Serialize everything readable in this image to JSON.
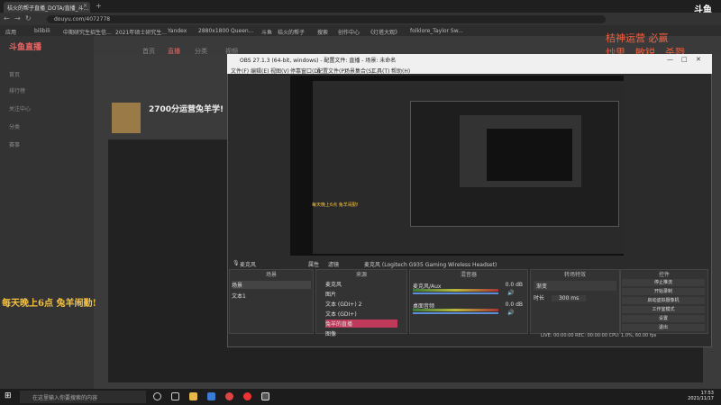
{
  "browser": {
    "tab_title": "桔火的帮子直播_DOTA/直播_斗...",
    "url": "douyu.com/4072778",
    "bookmarks": [
      "应用",
      "bilibili",
      "中期研究生招生信...",
      "2021年硕士研究生...",
      "Yandex",
      "2880x1800 Queen...",
      "斗鱼",
      "桔火的帮子",
      "搜索",
      "创作中心",
      "《灯塔大观》",
      "folklore_Taylor Sw..."
    ]
  },
  "site": {
    "logo": "斗鱼直播",
    "nav": [
      "首页",
      "直播",
      "分类",
      "视频",
      "游戏",
      "鱼吧",
      "鱼乐星座"
    ],
    "sidebar": [
      "首页",
      "排行榜",
      "关注中心",
      "分类",
      "赛事"
    ],
    "room_title": "2700分运营兔羊学!",
    "promo": "每天晚上6点 兔羊闹勤!",
    "watermark_top": "桔神运营 必赢",
    "watermark_bottom": "炒思、敏锐、杀戮"
  },
  "obs": {
    "title": "OBS 27.1.3 (64-bit, windows) - 配置文件: 直播 - 场景: 未命名",
    "menu": [
      "文件(F)",
      "编辑(E)",
      "视图(V)",
      "停靠窗口(D)",
      "配置文件(P)",
      "场景集合(S)",
      "工具(T)",
      "帮助(H)"
    ],
    "overlay_text": "每天晚上6点 兔羊闹勤!",
    "status_source": "麦克风",
    "status_props": "属性",
    "status_filters": "滤镜",
    "status_device": "麦克风 (Logitech G935 Gaming Wireless Headset)",
    "scenes_header": "场景",
    "scenes": [
      "场景",
      "文本1"
    ],
    "sources_header": "来源",
    "sources": [
      "麦克风",
      "图片",
      "文本 (GDI+) 2",
      "文本 (GDI+)",
      "兔羊的直播",
      "图像"
    ],
    "mixer_header": "混音器",
    "mixer": [
      {
        "name": "麦克风/Aux",
        "db": "0.0 dB"
      },
      {
        "name": "桌面音频",
        "db": "0.0 dB"
      }
    ],
    "transitions_header": "转场特效",
    "transition": "渐变",
    "duration_label": "时长",
    "duration": "300 ms",
    "controls_header": "控件",
    "controls": [
      "停止推流",
      "开始录制",
      "启动虚拟摄像机",
      "工作室模式",
      "设置",
      "退出"
    ],
    "footer": "LIVE: 00:00:00   REC: 00:00:00   CPU: 1.0%, 60.00 fps"
  },
  "taskbar": {
    "search_placeholder": "在这里输入你要搜索的内容",
    "time": "17:53",
    "date": "2021/11/17"
  },
  "colors": {
    "accent": "#f06040",
    "promo": "#f6c23e"
  }
}
